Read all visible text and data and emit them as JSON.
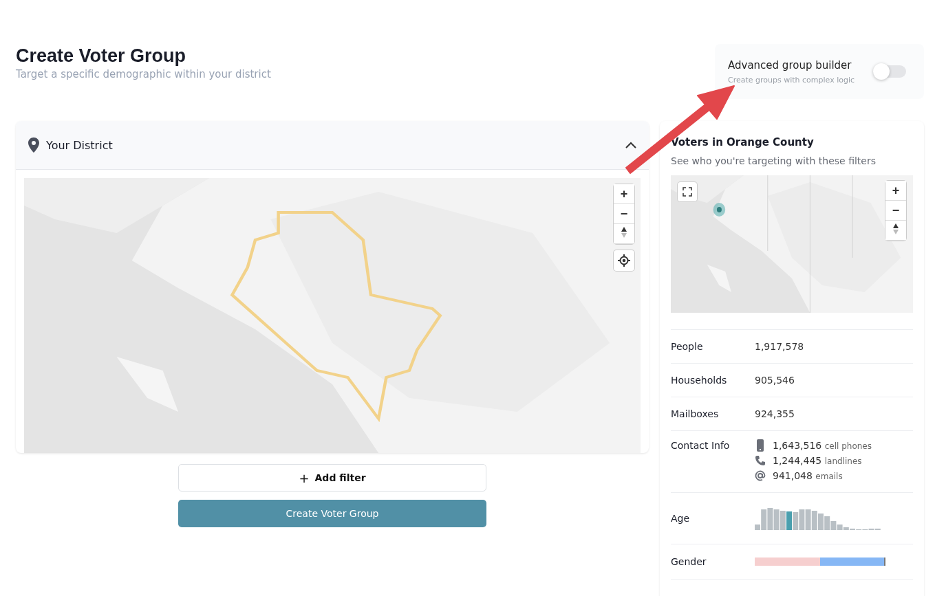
{
  "header": {
    "title": "Create Voter Group",
    "subtitle": "Target a specific demographic within your district"
  },
  "advanced": {
    "title": "Advanced group builder",
    "subtitle": "Create groups with complex logic",
    "on": false
  },
  "district": {
    "title": "Your District",
    "expanded": true,
    "map": {
      "kind": "picture",
      "controls": [
        "+",
        "−"
      ]
    }
  },
  "add_filter": {
    "icon": "+",
    "label": "Add filter"
  },
  "create_button": "Create Voter Group",
  "summary": {
    "title": "Voters in Orange County",
    "subtitle": "See who you're targeting with these filters",
    "map": {
      "kind": "picture",
      "controls": [
        "+",
        "−"
      ]
    },
    "rows": [
      {
        "kind": "value",
        "label": "People",
        "value": "1,917,578"
      },
      {
        "kind": "value",
        "label": "Households",
        "value": "905,546"
      },
      {
        "kind": "value",
        "label": "Mailboxes",
        "value": "924,355"
      },
      {
        "kind": "contact",
        "label": "Contact Info",
        "items": [
          {
            "value": "1,643,516",
            "unit": "cell phones"
          },
          {
            "value": "1,244,445",
            "unit": "landlines"
          },
          {
            "value": "941,048",
            "unit": "emails"
          }
        ]
      },
      {
        "kind": "histogram",
        "label": "Age"
      },
      {
        "kind": "gender",
        "label": "Gender"
      }
    ]
  }
}
